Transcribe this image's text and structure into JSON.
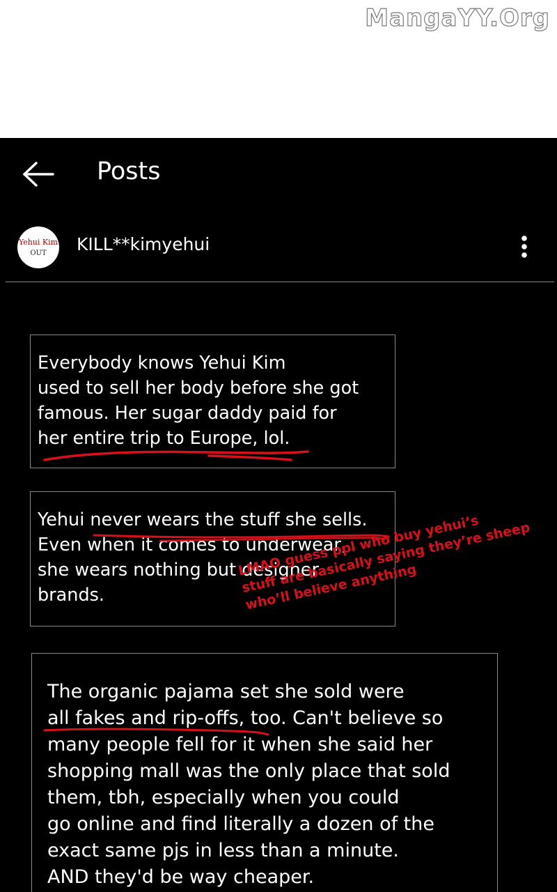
{
  "watermark": "MangaYY.Org",
  "header": {
    "back_icon": "left-arrow-icon",
    "title": "Posts"
  },
  "profile": {
    "avatar_line1": "Yehui Kim",
    "avatar_line2": "OUT",
    "username": "KILL**kimyehui",
    "menu_icon": "vertical-ellipsis-icon"
  },
  "posts": [
    {
      "lines": "Everybody knows Yehui Kim\nused to sell her body before she got\nfamous. Her sugar daddy paid for\nher entire trip to Europe, lol."
    },
    {
      "lines": "Yehui never wears the stuff she sells.\nEven when it comes to underwear,\nshe wears nothing but designer\nbrands."
    },
    {
      "lines": "The organic pajama set she sold were\nall fakes and rip-offs, too. Can't believe so\nmany people fell for it when she said her\nshopping mall was the only place that sold\nthem, tbh, especially when you could\ngo online and find literally a dozen of the\nexact same pjs in less than a minute.\nAND they'd be way cheaper."
    }
  ],
  "handwritten_comment": "LMAO guess ppl who buy yehui’s\nstuff are basically saying they’re sheep\nwho’ll believe anything",
  "colors": {
    "screen_bg": "#000000",
    "text": "#ffffff",
    "annotation_red": "#d8101a",
    "border_gray": "#8a8a8a"
  }
}
